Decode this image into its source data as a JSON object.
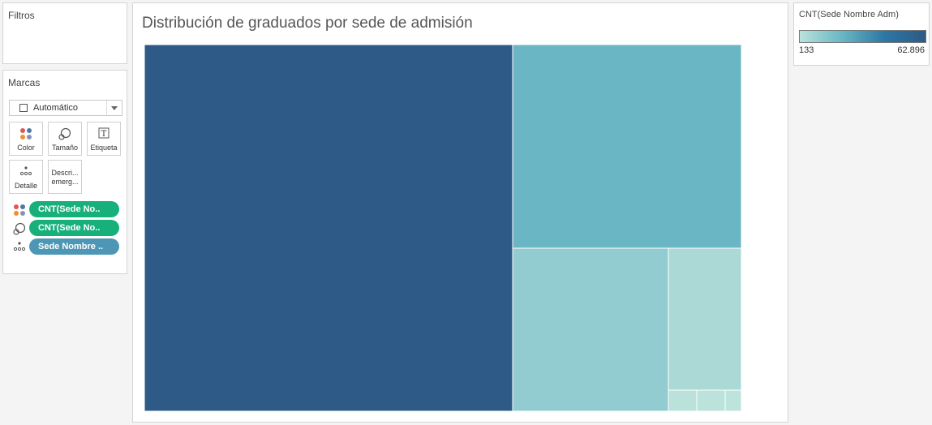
{
  "filters": {
    "title": "Filtros"
  },
  "marks": {
    "title": "Marcas",
    "mark_type": "Automático",
    "buttons": [
      {
        "label": "Color",
        "icon": "color-dots-icon"
      },
      {
        "label": "Tamaño",
        "icon": "size-lasso-icon"
      },
      {
        "label": "Etiqueta",
        "icon": "label-t-icon"
      },
      {
        "label": "Detalle",
        "icon": "detail-dots-icon"
      },
      {
        "label_line1": "Descri...",
        "label_line2": "emerg...",
        "icon": "none"
      }
    ],
    "pills": [
      {
        "icon": "color-dots-icon",
        "text": "CNT(Sede No..",
        "color": "#17b07b"
      },
      {
        "icon": "size-lasso-icon",
        "text": "CNT(Sede No..",
        "color": "#17b07b"
      },
      {
        "icon": "detail-dots-icon",
        "text": "Sede Nombre ..",
        "color": "#4e96b5"
      }
    ]
  },
  "viz": {
    "title": "Distribución de graduados por sede de admisión"
  },
  "legend": {
    "title": "CNT(Sede Nombre Adm)",
    "min_label": "133",
    "max_label": "62.896",
    "colors": [
      "#b9e2db",
      "#6ab7c4",
      "#2e78a5",
      "#2d5a86"
    ]
  },
  "chart_data": {
    "type": "treemap",
    "title": "Distribución de graduados por sede de admisión",
    "color_measure": "CNT(Sede Nombre Adm)",
    "color_range": [
      133,
      62896
    ],
    "tiles": [
      {
        "value": 62896,
        "color": "#2d5a86"
      },
      {
        "value": 30500,
        "color": "#6ab6c4"
      },
      {
        "value": 17800,
        "color": "#92ccd0"
      },
      {
        "value": 9500,
        "color": "#abdad6"
      },
      {
        "value": 620,
        "color": "#bae2db"
      },
      {
        "value": 560,
        "color": "#bbe2db"
      },
      {
        "value": 133,
        "color": "#bce3dc"
      }
    ]
  }
}
